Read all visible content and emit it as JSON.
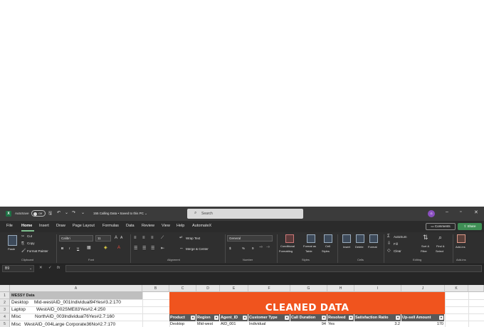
{
  "titlebar": {
    "autosave_label": "AutoSave",
    "autosave_state": "Off",
    "filename": "155 Calling Data • Saved to this PC ⌄",
    "search_placeholder": "Search",
    "avatar_initial": "G",
    "logo_letter": "X"
  },
  "menu": {
    "tabs": [
      "File",
      "Home",
      "Insert",
      "Draw",
      "Page Layout",
      "Formulas",
      "Data",
      "Review",
      "View",
      "Help",
      "AutomateX"
    ],
    "active_tab": "Home",
    "comments_label": "Comments",
    "share_label": "Share"
  },
  "ribbon": {
    "clipboard": {
      "paste": "Paste",
      "cut": "Cut",
      "copy": "Copy",
      "format_painter": "Format Painter",
      "label": "Clipboard"
    },
    "font": {
      "name": "Calibri",
      "size": "11",
      "label": "Font",
      "bold": "B",
      "italic": "I",
      "underline": "U"
    },
    "alignment": {
      "wrap_text": "Wrap Text",
      "merge_center": "Merge & Center",
      "label": "Alignment"
    },
    "number": {
      "format": "General",
      "currency": "$",
      "percent": "%",
      "comma": "9",
      "label": "Number"
    },
    "styles": {
      "conditional": "Conditional",
      "conditional2": "Formatting",
      "format_as": "Format as",
      "format_as2": "Table",
      "cell": "Cell",
      "cell2": "Styles",
      "label": "Styles"
    },
    "cells": {
      "insert": "Insert",
      "delete": "Delete",
      "format": "Format",
      "label": "Cells"
    },
    "editing": {
      "autosum": "AutoSum",
      "fill": "Fill",
      "clear": "Clear",
      "sort": "Sort &",
      "sort2": "Filter",
      "find": "Find &",
      "find2": "Select",
      "label": "Editing"
    },
    "addins": {
      "name": "Add-ins",
      "label": "Add-ins"
    }
  },
  "formula_bar": {
    "name_box": "B9",
    "fx": "fx",
    "value": ""
  },
  "grid": {
    "columns": [
      "A",
      "B",
      "C",
      "D",
      "E",
      "F",
      "G",
      "H",
      "I",
      "J",
      "K"
    ],
    "rows": [
      "1",
      "2",
      "3",
      "4",
      "5"
    ],
    "messy_header": "MESSY Data",
    "messy_rows": [
      {
        "a": "Desktop",
        "rest": "Mid-westAID_001Individual94Yes#3.2:170"
      },
      {
        "a": "Laptop",
        "rest": "WestAID_002SME83Yes#2.4:250"
      },
      {
        "a": "Misc",
        "rest": "NorthAID_003Individual76Yes#2.7:160"
      },
      {
        "a": "Misc",
        "rest": "WestAID_004Large Corporate36No#2.7:170"
      }
    ],
    "cleaned_title": "CLEANED DATA",
    "table_headers": [
      "Product",
      "Region",
      "Agent_ID",
      "Customer Type",
      "Call Duration",
      "Resolved",
      "Satisfaction Ratio",
      "Up-sell Amount"
    ],
    "table_row": [
      "Desktop",
      "Mid-west",
      "AID_001",
      "Individual",
      "94",
      "Yes",
      "3.2",
      "170"
    ]
  }
}
